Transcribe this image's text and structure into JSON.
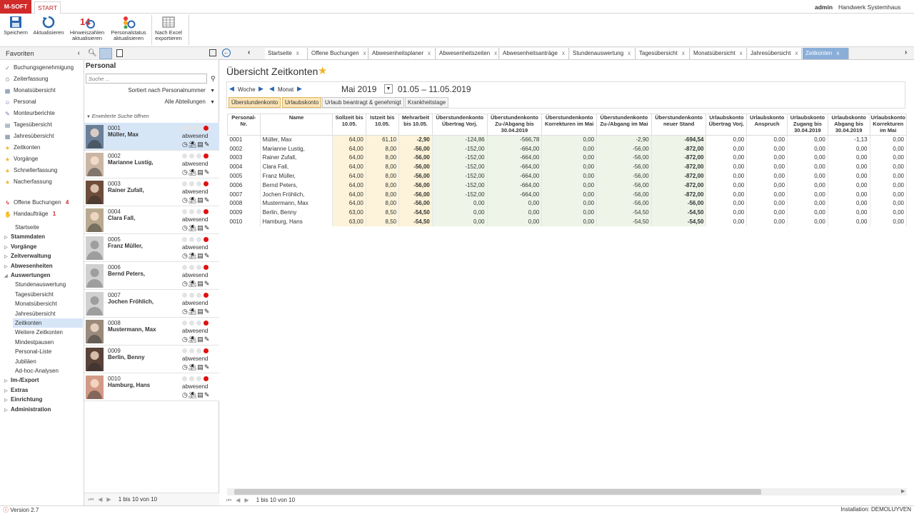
{
  "app": {
    "logo": "M-SOFT",
    "start_tab": "START",
    "user": "admin",
    "company": "Handwerk Systemhaus"
  },
  "ribbon": [
    {
      "label": "Speichern",
      "icon": "save-icon"
    },
    {
      "label": "Aktualisieren",
      "icon": "refresh-icon"
    },
    {
      "label": "Hinweiszahlen aktualisieren",
      "icon": "badge-refresh-icon",
      "badge": "14"
    },
    {
      "label": "Personalstatus aktualisieren",
      "icon": "status-refresh-icon"
    },
    {
      "label": "Nach Excel exportieren",
      "icon": "excel-icon"
    }
  ],
  "nav": {
    "favorites_title": "Favoriten",
    "favorites": [
      "Buchungsgenehmigung",
      "Zeiterfassung",
      "Monatsübersicht",
      "Personal",
      "Monteurberichte",
      "Tagesübersicht",
      "Jahresübersicht",
      "Zeitkonten",
      "Vorgänge",
      "Schnellerfassung",
      "Nacherfassung"
    ],
    "open_bookings": {
      "label": "Offene Buchungen",
      "count": "4"
    },
    "hand_orders": {
      "label": "Handaufträge",
      "count": "1"
    },
    "tree": [
      {
        "label": "Startseite",
        "level": 1,
        "bold": false
      },
      {
        "label": "Stammdaten",
        "level": 0,
        "bold": true
      },
      {
        "label": "Vorgänge",
        "level": 0,
        "bold": true
      },
      {
        "label": "Zeitverwaltung",
        "level": 0,
        "bold": true
      },
      {
        "label": "Abwesenheiten",
        "level": 0,
        "bold": true
      },
      {
        "label": "Auswertungen",
        "level": 0,
        "bold": true,
        "open": true
      },
      {
        "label": "Stundenauswertung",
        "level": 1,
        "bold": false
      },
      {
        "label": "Tagesübersicht",
        "level": 1,
        "bold": false
      },
      {
        "label": "Monatsübersicht",
        "level": 1,
        "bold": false
      },
      {
        "label": "Jahresübersicht",
        "level": 1,
        "bold": false
      },
      {
        "label": "Zeitkonten",
        "level": 1,
        "bold": false,
        "selected": true
      },
      {
        "label": "Weitere Zeitkonten",
        "level": 1,
        "bold": false
      },
      {
        "label": "Mindestpausen",
        "level": 1,
        "bold": false
      },
      {
        "label": "Personal-Liste",
        "level": 1,
        "bold": false
      },
      {
        "label": "Jubiläen",
        "level": 1,
        "bold": false
      },
      {
        "label": "Ad-hoc-Analysen",
        "level": 1,
        "bold": false
      },
      {
        "label": "Im-/Export",
        "level": 0,
        "bold": true
      },
      {
        "label": "Extras",
        "level": 0,
        "bold": true
      },
      {
        "label": "Einrichtung",
        "level": 0,
        "bold": true
      },
      {
        "label": "Administration",
        "level": 0,
        "bold": true
      }
    ]
  },
  "personal": {
    "title": "Personal",
    "search_placeholder": "Suche ...",
    "sort": "Sortiert nach Personalnummer",
    "dept": "Alle Abteilungen",
    "extended": "Erweiterte Suche öffnen",
    "status": "abwesend",
    "footer": "1 bis 10 von 10",
    "rows": [
      {
        "num": "0001",
        "name": "Müller, Max",
        "photo": true
      },
      {
        "num": "0002",
        "name": "Marianne Lustig,",
        "photo": true
      },
      {
        "num": "0003",
        "name": "Rainer Zufall,",
        "photo": true
      },
      {
        "num": "0004",
        "name": "Clara Fall,",
        "photo": true
      },
      {
        "num": "0005",
        "name": "Franz Müller,",
        "photo": false
      },
      {
        "num": "0006",
        "name": "Bernd Peters,",
        "photo": false
      },
      {
        "num": "0007",
        "name": "Jochen Fröhlich,",
        "photo": false
      },
      {
        "num": "0008",
        "name": "Mustermann, Max",
        "photo": true
      },
      {
        "num": "0009",
        "name": "Berlin, Benny",
        "photo": true
      },
      {
        "num": "0010",
        "name": "Hamburg, Hans",
        "photo": true
      }
    ]
  },
  "tabs": [
    "Startseite",
    "Offene Buchungen",
    "Abwesenheitsplaner",
    "Abwesenheitszeiten",
    "Abwesenheitsanträge",
    "Stundenauswertung",
    "Tagesübersicht",
    "Monatsübersicht",
    "Jahresübersicht",
    "Zeitkonten"
  ],
  "main": {
    "title": "Übersicht Zeitkonten",
    "week": "Woche",
    "month": "Monat",
    "period": "Mai 2019",
    "range": "01.05 – 11.05.2019",
    "filters": [
      "Überstundenkonto",
      "Urlaubskonto",
      "Urlaub beantragt & genehmigt",
      "Krankheitstage"
    ],
    "footer": "1 bis 10 von 10"
  },
  "table": {
    "headers": [
      "Personal-Nr.",
      "Name",
      "Sollzeit bis 10.05.",
      "Istzeit bis 10.05.",
      "Mehrarbeit bis 10.05.",
      "Überstundenkonto Übertrag Vorj.",
      "Überstundenkonto Zu-/Abgang bis 30.04.2019",
      "Überstundenkonto Korrekturen im Mai",
      "Überstundenkonto Zu-/Abgang im Mai",
      "Überstundenkonto neuer Stand",
      "Urlaubskonto Übertrag Vorj.",
      "Urlaubskonto Anspruch",
      "Urlaubskonto Zugang bis 30.04.2019",
      "Urlaubskonto Abgang bis 30.04.2019",
      "Urlaubskonto Korrekturen im Mai"
    ],
    "rows": [
      [
        "0001",
        "Müller, Max",
        "64,00",
        "61,10",
        "-2,90",
        "-124,86",
        "-566,78",
        "0,00",
        "-2,90",
        "-694,54",
        "0,00",
        "0,00",
        "0,00",
        "-1,13",
        "0,00"
      ],
      [
        "0002",
        "Marianne Lustig,",
        "64,00",
        "8,00",
        "-56,00",
        "-152,00",
        "-664,00",
        "0,00",
        "-56,00",
        "-872,00",
        "0,00",
        "0,00",
        "0,00",
        "0,00",
        "0,00"
      ],
      [
        "0003",
        "Rainer Zufall,",
        "64,00",
        "8,00",
        "-56,00",
        "-152,00",
        "-664,00",
        "0,00",
        "-56,00",
        "-872,00",
        "0,00",
        "0,00",
        "0,00",
        "0,00",
        "0,00"
      ],
      [
        "0004",
        "Clara Fall,",
        "64,00",
        "8,00",
        "-56,00",
        "-152,00",
        "-664,00",
        "0,00",
        "-56,00",
        "-872,00",
        "0,00",
        "0,00",
        "0,00",
        "0,00",
        "0,00"
      ],
      [
        "0005",
        "Franz Müller,",
        "64,00",
        "8,00",
        "-56,00",
        "-152,00",
        "-664,00",
        "0,00",
        "-56,00",
        "-872,00",
        "0,00",
        "0,00",
        "0,00",
        "0,00",
        "0,00"
      ],
      [
        "0006",
        "Bernd Peters,",
        "64,00",
        "8,00",
        "-56,00",
        "-152,00",
        "-664,00",
        "0,00",
        "-56,00",
        "-872,00",
        "0,00",
        "0,00",
        "0,00",
        "0,00",
        "0,00"
      ],
      [
        "0007",
        "Jochen Fröhlich,",
        "64,00",
        "8,00",
        "-56,00",
        "-152,00",
        "-664,00",
        "0,00",
        "-56,00",
        "-872,00",
        "0,00",
        "0,00",
        "0,00",
        "0,00",
        "0,00"
      ],
      [
        "0008",
        "Mustermann, Max",
        "64,00",
        "8,00",
        "-56,00",
        "0,00",
        "0,00",
        "0,00",
        "-56,00",
        "-56,00",
        "0,00",
        "0,00",
        "0,00",
        "0,00",
        "0,00"
      ],
      [
        "0009",
        "Berlin, Benny",
        "63,00",
        "8,50",
        "-54,50",
        "0,00",
        "0,00",
        "0,00",
        "-54,50",
        "-54,50",
        "0,00",
        "0,00",
        "0,00",
        "0,00",
        "0,00"
      ],
      [
        "0010",
        "Hamburg, Hans",
        "63,00",
        "8,50",
        "-54,50",
        "0,00",
        "0,00",
        "0,00",
        "-54,50",
        "-54,50",
        "0,00",
        "0,00",
        "0,00",
        "0,00",
        "0,00"
      ]
    ]
  },
  "status_bar": {
    "version": "Version 2.7",
    "installation": "Installation: DEMOLUYVEN"
  },
  "colors": {
    "accent": "#d12a2a",
    "tab_active": "#8aaed8",
    "selected_row": "#d7e6f7",
    "yellow_col": "#fdf3da",
    "green_col": "#eef5e8"
  }
}
